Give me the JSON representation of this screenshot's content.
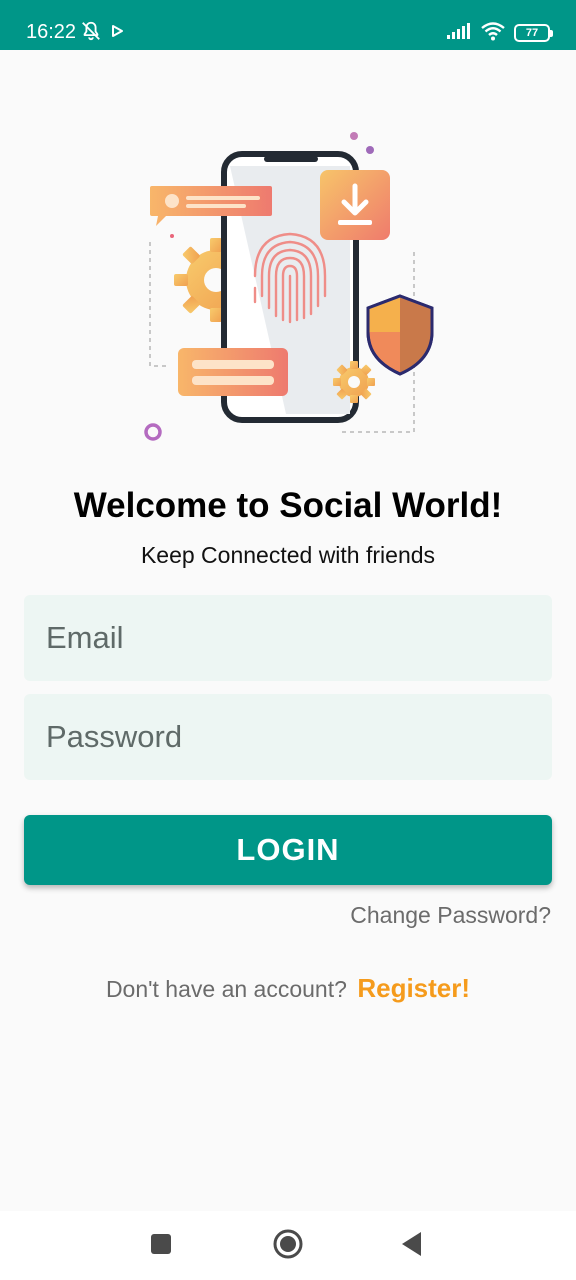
{
  "status_bar": {
    "time": "16:22",
    "battery_level": "77",
    "background_color": "#009688",
    "left_icons": [
      "notifications-off-icon",
      "play-icon"
    ],
    "right_icons": [
      "signal-icon",
      "wifi-icon",
      "battery-icon"
    ]
  },
  "hero": {
    "illustration": "phone-fingerprint-security-illustration"
  },
  "welcome": {
    "title": "Welcome to Social World!",
    "subtitle": "Keep Connected with friends"
  },
  "form": {
    "email_placeholder": "Email",
    "email_value": "",
    "password_placeholder": "Password",
    "password_value": "",
    "login_label": "LOGIN",
    "change_password_label": "Change Password?"
  },
  "register": {
    "prompt": "Don't have an account?",
    "link_label": "Register!"
  },
  "nav_bar": {
    "items": [
      "recents-icon",
      "home-icon",
      "back-icon"
    ]
  },
  "colors": {
    "primary": "#009688",
    "accent": "#f59b1c",
    "field_background": "#edf6f3",
    "page_background": "#fafafa"
  }
}
